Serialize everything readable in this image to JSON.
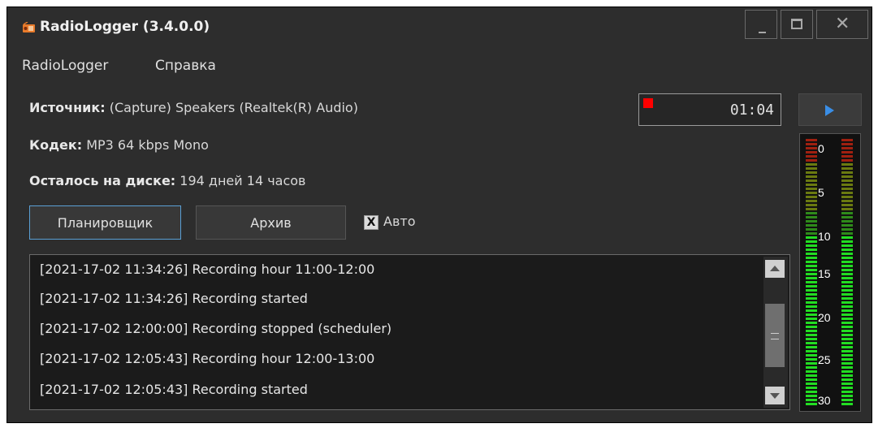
{
  "window": {
    "title": "RadioLogger (3.4.0.0)",
    "app_icon": "radio-icon",
    "controls": {
      "minimize": "minimize-icon",
      "maximize": "maximize-icon",
      "close_glyph": "✕"
    }
  },
  "menu": [
    "RadioLogger",
    "Справка"
  ],
  "info": {
    "source_label": "Источник:",
    "source_value": "(Capture) Speakers (Realtek(R) Audio)",
    "codec_label": "Кодек:",
    "codec_value": "MP3 64 kbps Mono",
    "disk_label": "Осталось на диске:",
    "disk_value": "194 дней 14 часов"
  },
  "recorder": {
    "time": "01:04",
    "recording": true,
    "record_color": "#ff0000",
    "play_icon": "play-icon",
    "play_color": "#3a8ee6"
  },
  "buttons": {
    "scheduler": "Планировщик",
    "archive": "Архив",
    "auto_checkbox_mark": "X",
    "auto_label": "Авто",
    "auto_checked": true
  },
  "log": {
    "lines": [
      "[2021-17-02 11:34:26] Recording hour 11:00-12:00",
      "[2021-17-02 11:34:26] Recording started",
      "[2021-17-02 12:00:00] Recording stopped (scheduler)",
      "[2021-17-02 12:05:43] Recording hour 12:00-13:00",
      "[2021-17-02 12:05:43] Recording started"
    ]
  },
  "vu_meter": {
    "scale_labels": [
      "0",
      "5",
      "10",
      "15",
      "20",
      "25",
      "30"
    ],
    "colors": {
      "top": "#a02010",
      "upper": "#6a7a10",
      "mid": "#2e8a1a",
      "lit": "#22dd22"
    }
  }
}
